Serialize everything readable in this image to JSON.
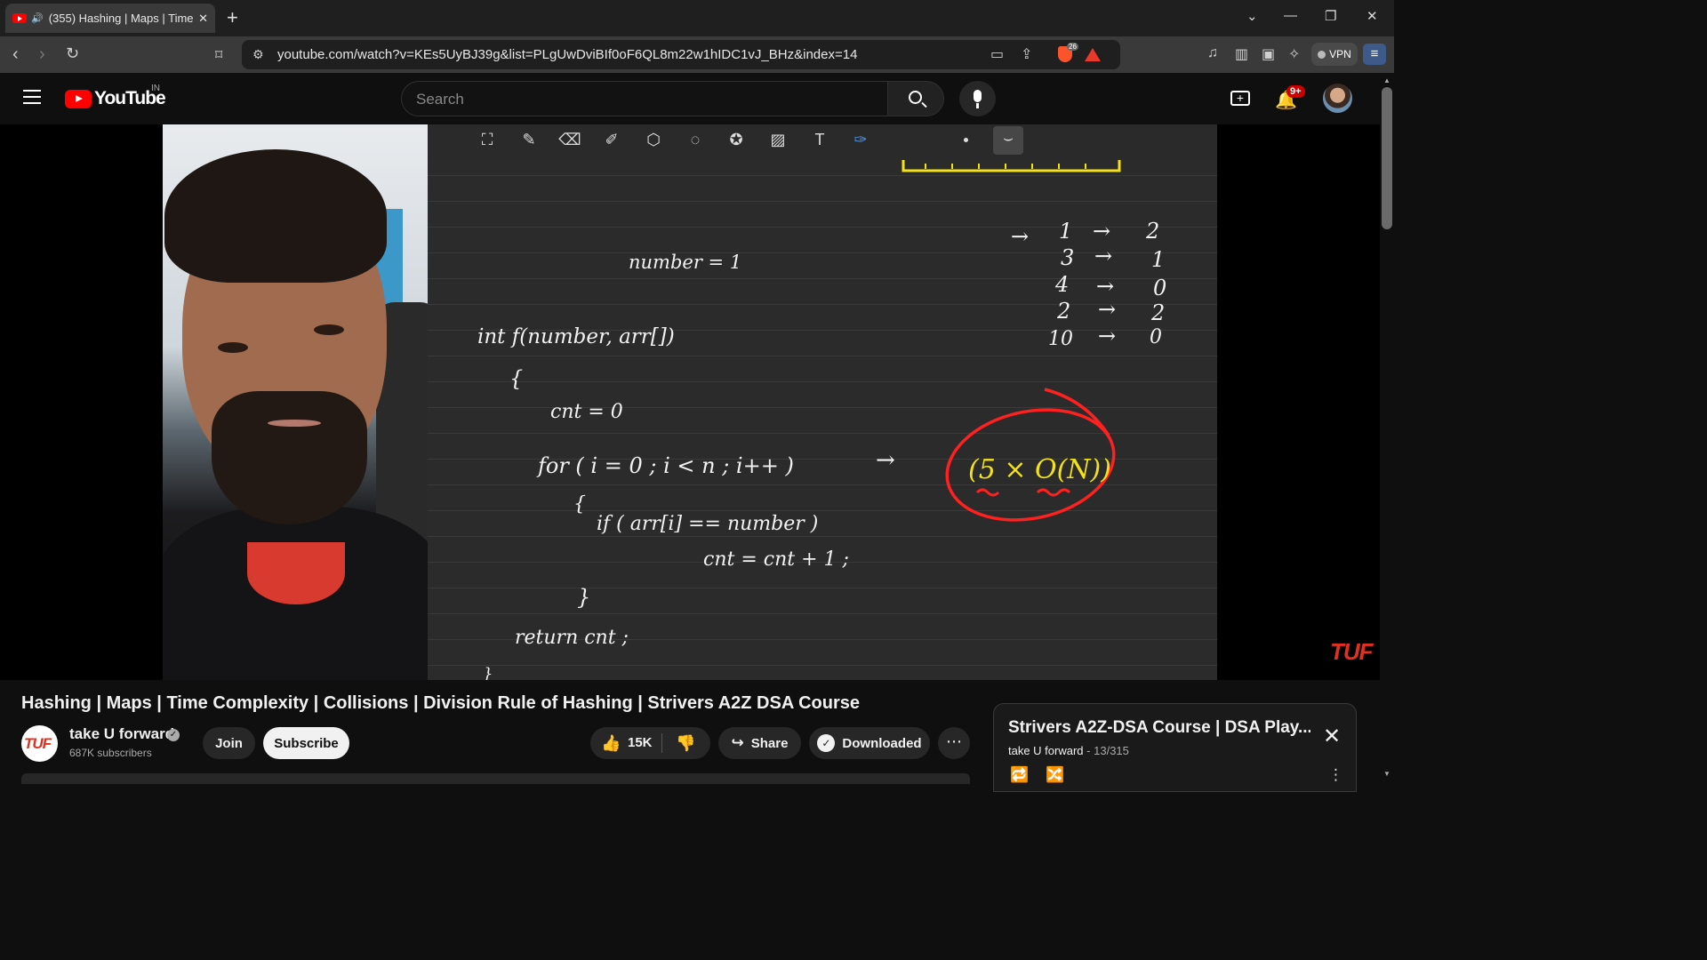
{
  "browser": {
    "tab_title": "(355) Hashing | Maps | Time Complexity | Collisions | Division Rule of Hashing",
    "speaker_icon": "speaker-icon",
    "close_glyph": "✕",
    "new_tab_glyph": "+",
    "url": "youtube.com/watch?v=KEs5UyBJ39g&list=PLgUwDviBIf0oF6QL8m22w1hIDC1vJ_BHz&index=14",
    "brave_shield_count": "26",
    "vpn_label": "VPN",
    "window_controls": [
      "⌄",
      "—",
      "❐",
      "✕"
    ]
  },
  "youtube": {
    "logo_text": "YouTube",
    "country_code": "IN",
    "search_placeholder": "Search",
    "notification_count": "9+"
  },
  "video": {
    "whiteboard": {
      "list_pairs": [
        {
          "key": "1",
          "value": "2"
        },
        {
          "key": "3",
          "value": "1"
        },
        {
          "key": "4",
          "value": "0"
        },
        {
          "key": "2",
          "value": "2"
        },
        {
          "key": "10",
          "value": "0"
        }
      ],
      "line_number": "number = 1",
      "line_signature": "int f(number, arr[])",
      "line_open_brace": "{",
      "line_cnt": "cnt = 0",
      "line_for": "for ( i = 0 ; i < n ; i++ )",
      "line_for_open": "{",
      "line_if": "if ( arr[i] == number )",
      "line_incr": "cnt = cnt + 1 ;",
      "line_for_close": "}",
      "line_return": "return cnt ;",
      "line_close": "}",
      "circled_note": "(5 × O(N))",
      "arrow": "→"
    },
    "watermark": "TUF"
  },
  "details": {
    "title": "Hashing | Maps | Time Complexity | Collisions | Division Rule of Hashing | Strivers A2Z DSA Course",
    "channel_logo_text": "TUF",
    "channel_name": "take U forward",
    "subscribers": "687K subscribers",
    "join_label": "Join",
    "subscribe_label": "Subscribe",
    "likes": "15K",
    "share_label": "Share",
    "downloaded_label": "Downloaded",
    "more_glyph": "⋯"
  },
  "playlist": {
    "title": "Strivers A2Z-DSA Course | DSA Play...",
    "channel": "take U forward",
    "position": "13/315",
    "close_glyph": "✕"
  }
}
